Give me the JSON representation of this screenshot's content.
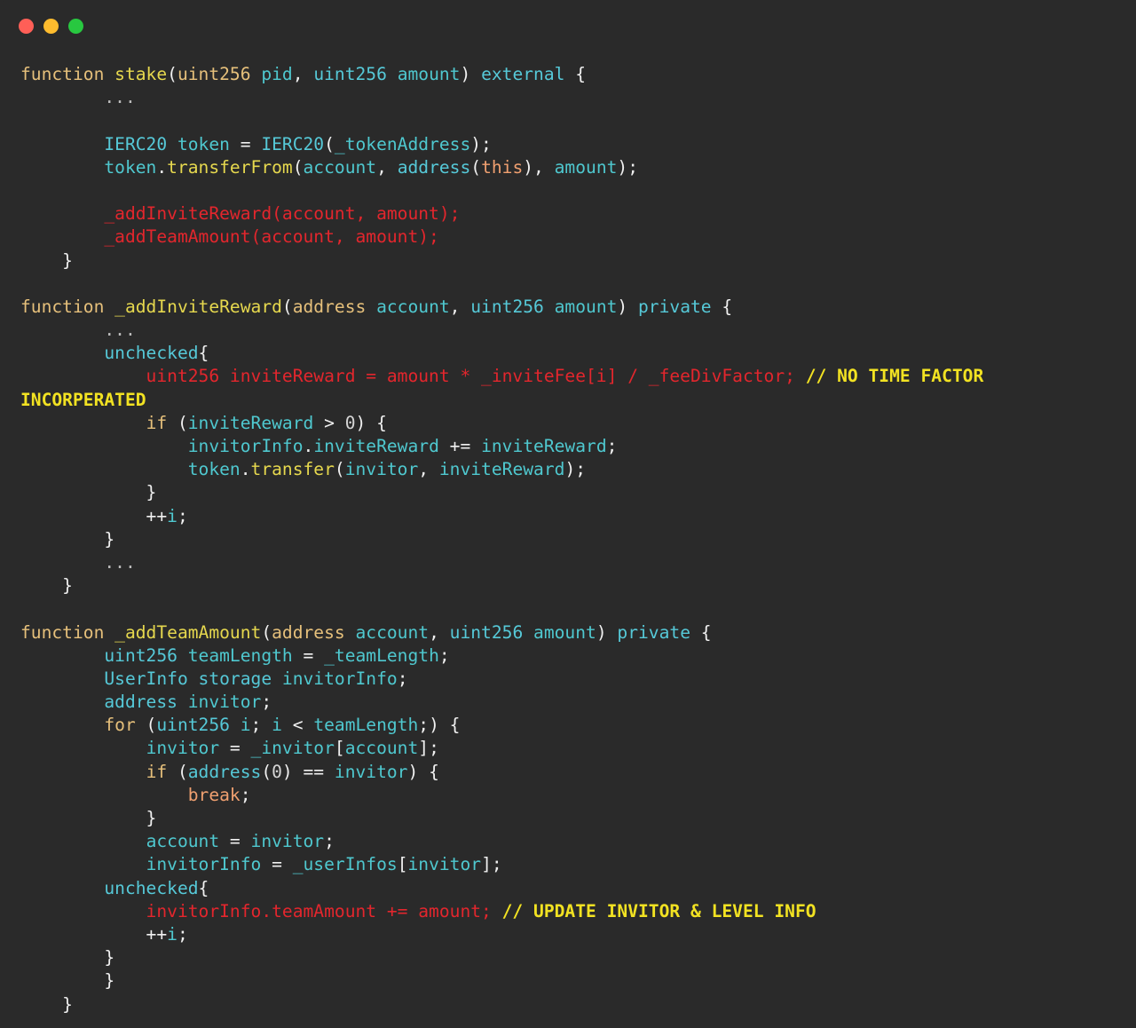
{
  "window": {
    "controls": {
      "close_color": "#ff5f57",
      "minimize_color": "#febc2e",
      "maximize_color": "#28c840"
    }
  },
  "colors": {
    "kw": "#e6c07b",
    "fn": "#e6d84e",
    "tp": "#56c9d8",
    "id": "#4fc8cf",
    "pn": "#f0f0f0",
    "hl": "#e3262d",
    "cm": "#f2e222",
    "nm": "#d6d6d6",
    "ot": "#f0a070",
    "dim": "#bdbdbd"
  },
  "code_lines": [
    [
      [
        "kw",
        "function "
      ],
      [
        "fn",
        "stake"
      ],
      [
        "pn",
        "("
      ],
      [
        "kw",
        "uint256 "
      ],
      [
        "id",
        "pid"
      ],
      [
        "pn",
        ", "
      ],
      [
        "tp",
        "uint256 "
      ],
      [
        "id",
        "amount"
      ],
      [
        "pn",
        ") "
      ],
      [
        "tp",
        "external"
      ],
      [
        "pn",
        " {"
      ]
    ],
    [
      [
        "dim",
        "        ..."
      ]
    ],
    [],
    [
      [
        "pn",
        "        "
      ],
      [
        "tp",
        "IERC20 "
      ],
      [
        "id",
        "token"
      ],
      [
        "pn",
        " = "
      ],
      [
        "tp",
        "IERC20"
      ],
      [
        "pn",
        "("
      ],
      [
        "id",
        "_tokenAddress"
      ],
      [
        "pn",
        ");"
      ]
    ],
    [
      [
        "pn",
        "        "
      ],
      [
        "id",
        "token"
      ],
      [
        "pn",
        "."
      ],
      [
        "fn",
        "transferFrom"
      ],
      [
        "pn",
        "("
      ],
      [
        "id",
        "account"
      ],
      [
        "pn",
        ", "
      ],
      [
        "tp",
        "address"
      ],
      [
        "pn",
        "("
      ],
      [
        "ot",
        "this"
      ],
      [
        "pn",
        "), "
      ],
      [
        "id",
        "amount"
      ],
      [
        "pn",
        ");"
      ]
    ],
    [],
    [
      [
        "hl",
        "        _addInviteReward(account, amount);"
      ]
    ],
    [
      [
        "hl",
        "        _addTeamAmount(account, amount);"
      ]
    ],
    [
      [
        "pn",
        "    }"
      ]
    ],
    [],
    [
      [
        "kw",
        "function "
      ],
      [
        "fn",
        "_addInviteReward"
      ],
      [
        "pn",
        "("
      ],
      [
        "kw",
        "address "
      ],
      [
        "id",
        "account"
      ],
      [
        "pn",
        ", "
      ],
      [
        "tp",
        "uint256 "
      ],
      [
        "id",
        "amount"
      ],
      [
        "pn",
        ") "
      ],
      [
        "tp",
        "private"
      ],
      [
        "pn",
        " {"
      ]
    ],
    [
      [
        "dim",
        "        ..."
      ]
    ],
    [
      [
        "pn",
        "        "
      ],
      [
        "tp",
        "unchecked"
      ],
      [
        "pn",
        "{"
      ]
    ],
    [
      [
        "hl",
        "            uint256 inviteReward = amount * _inviteFee[i] / _feeDivFactor;"
      ],
      [
        "cm",
        " // NO TIME FACTOR"
      ]
    ],
    [
      [
        "cm",
        "INCORPERATED"
      ]
    ],
    [
      [
        "pn",
        "            "
      ],
      [
        "kw",
        "if"
      ],
      [
        "pn",
        " ("
      ],
      [
        "id",
        "inviteReward"
      ],
      [
        "pn",
        " > "
      ],
      [
        "nm",
        "0"
      ],
      [
        "pn",
        ") {"
      ]
    ],
    [
      [
        "pn",
        "                "
      ],
      [
        "id",
        "invitorInfo"
      ],
      [
        "pn",
        "."
      ],
      [
        "id",
        "inviteReward"
      ],
      [
        "pn",
        " += "
      ],
      [
        "id",
        "inviteReward"
      ],
      [
        "pn",
        ";"
      ]
    ],
    [
      [
        "pn",
        "                "
      ],
      [
        "id",
        "token"
      ],
      [
        "pn",
        "."
      ],
      [
        "fn",
        "transfer"
      ],
      [
        "pn",
        "("
      ],
      [
        "id",
        "invitor"
      ],
      [
        "pn",
        ", "
      ],
      [
        "id",
        "inviteReward"
      ],
      [
        "pn",
        ");"
      ]
    ],
    [
      [
        "pn",
        "            }"
      ]
    ],
    [
      [
        "pn",
        "            ++"
      ],
      [
        "id",
        "i"
      ],
      [
        "pn",
        ";"
      ]
    ],
    [
      [
        "pn",
        "        }"
      ]
    ],
    [
      [
        "dim",
        "        ..."
      ]
    ],
    [
      [
        "pn",
        "    }"
      ]
    ],
    [],
    [
      [
        "kw",
        "function "
      ],
      [
        "fn",
        "_addTeamAmount"
      ],
      [
        "pn",
        "("
      ],
      [
        "kw",
        "address "
      ],
      [
        "id",
        "account"
      ],
      [
        "pn",
        ", "
      ],
      [
        "tp",
        "uint256 "
      ],
      [
        "id",
        "amount"
      ],
      [
        "pn",
        ") "
      ],
      [
        "tp",
        "private"
      ],
      [
        "pn",
        " {"
      ]
    ],
    [
      [
        "pn",
        "        "
      ],
      [
        "tp",
        "uint256 "
      ],
      [
        "id",
        "teamLength"
      ],
      [
        "pn",
        " = "
      ],
      [
        "id",
        "_teamLength"
      ],
      [
        "pn",
        ";"
      ]
    ],
    [
      [
        "pn",
        "        "
      ],
      [
        "tp",
        "UserInfo storage "
      ],
      [
        "id",
        "invitorInfo"
      ],
      [
        "pn",
        ";"
      ]
    ],
    [
      [
        "pn",
        "        "
      ],
      [
        "tp",
        "address "
      ],
      [
        "id",
        "invitor"
      ],
      [
        "pn",
        ";"
      ]
    ],
    [
      [
        "pn",
        "        "
      ],
      [
        "kw",
        "for"
      ],
      [
        "pn",
        " ("
      ],
      [
        "tp",
        "uint256 "
      ],
      [
        "id",
        "i"
      ],
      [
        "pn",
        "; "
      ],
      [
        "id",
        "i"
      ],
      [
        "pn",
        " < "
      ],
      [
        "id",
        "teamLength"
      ],
      [
        "pn",
        ";) {"
      ]
    ],
    [
      [
        "pn",
        "            "
      ],
      [
        "id",
        "invitor"
      ],
      [
        "pn",
        " = "
      ],
      [
        "id",
        "_invitor"
      ],
      [
        "pn",
        "["
      ],
      [
        "id",
        "account"
      ],
      [
        "pn",
        "];"
      ]
    ],
    [
      [
        "pn",
        "            "
      ],
      [
        "kw",
        "if"
      ],
      [
        "pn",
        " ("
      ],
      [
        "tp",
        "address"
      ],
      [
        "pn",
        "("
      ],
      [
        "nm",
        "0"
      ],
      [
        "pn",
        ") == "
      ],
      [
        "id",
        "invitor"
      ],
      [
        "pn",
        ") {"
      ]
    ],
    [
      [
        "pn",
        "                "
      ],
      [
        "ot",
        "break"
      ],
      [
        "pn",
        ";"
      ]
    ],
    [
      [
        "pn",
        "            }"
      ]
    ],
    [
      [
        "pn",
        "            "
      ],
      [
        "id",
        "account"
      ],
      [
        "pn",
        " = "
      ],
      [
        "id",
        "invitor"
      ],
      [
        "pn",
        ";"
      ]
    ],
    [
      [
        "pn",
        "            "
      ],
      [
        "id",
        "invitorInfo"
      ],
      [
        "pn",
        " = "
      ],
      [
        "id",
        "_userInfos"
      ],
      [
        "pn",
        "["
      ],
      [
        "id",
        "invitor"
      ],
      [
        "pn",
        "];"
      ]
    ],
    [
      [
        "pn",
        "        "
      ],
      [
        "tp",
        "unchecked"
      ],
      [
        "pn",
        "{"
      ]
    ],
    [
      [
        "hl",
        "            invitorInfo.teamAmount += amount;"
      ],
      [
        "cm",
        " // UPDATE INVITOR & LEVEL INFO"
      ]
    ],
    [
      [
        "pn",
        "            ++"
      ],
      [
        "id",
        "i"
      ],
      [
        "pn",
        ";"
      ]
    ],
    [
      [
        "pn",
        "        }"
      ]
    ],
    [
      [
        "pn",
        "        }"
      ]
    ],
    [
      [
        "pn",
        "    }"
      ]
    ]
  ]
}
